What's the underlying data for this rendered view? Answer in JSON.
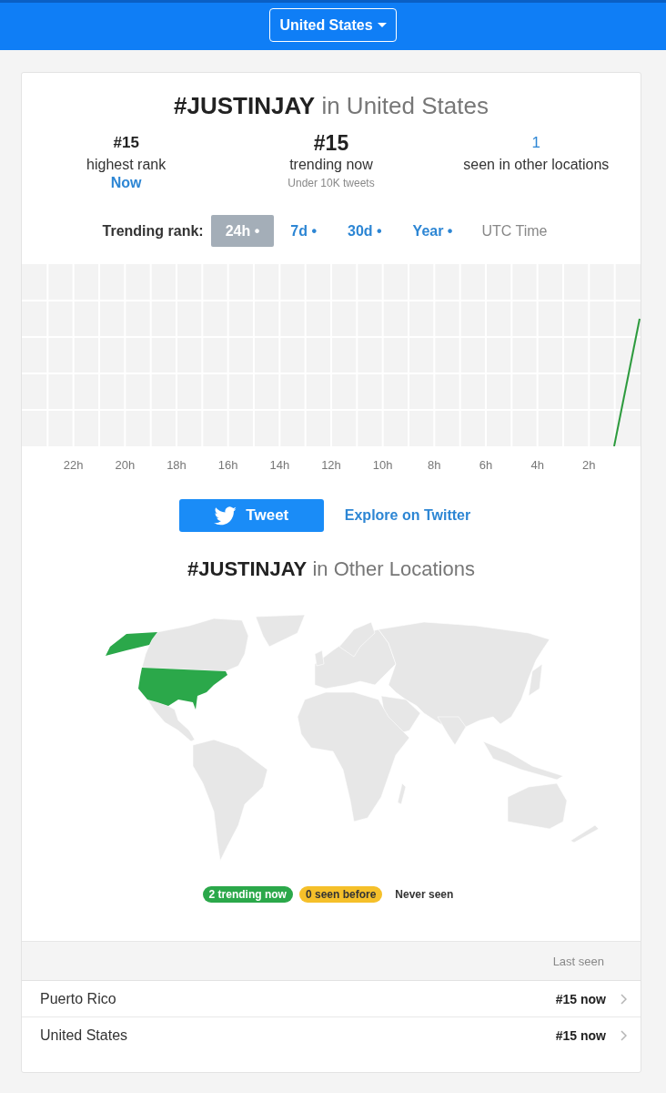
{
  "header": {
    "location_menu": "United States"
  },
  "title": "**#JUSTINJAY** in United States",
  "stats": [
    {
      "kind": "rank",
      "value": "#15",
      "label": "highest rank",
      "note": "Now"
    },
    {
      "kind": "current",
      "value": "#15",
      "label": "trending now",
      "note": "Under 10K tweets"
    },
    {
      "kind": "count",
      "value": "1",
      "label": "seen in other locations"
    }
  ],
  "range": {
    "label": "Trending rank:",
    "tabs": [
      {
        "label": "24h •",
        "selected": true
      },
      {
        "label": "7d •",
        "selected": false
      },
      {
        "label": "30d •",
        "selected": false
      },
      {
        "label": "Year •",
        "selected": false
      }
    ],
    "time_zone": "UTC Time"
  },
  "chart": {
    "x_labels": [
      "22h",
      "20h",
      "18h",
      "16h",
      "14h",
      "12h",
      "10h",
      "8h",
      "6h",
      "4h",
      "2h"
    ]
  },
  "actions": {
    "tweet": "Tweet",
    "explore": "Explore on Twitter"
  },
  "locations": {
    "title": "**#JUSTINJAY** in Other Locations",
    "legend": [
      {
        "kind": "trending",
        "label": "2 trending now",
        "color": "#2ba84a"
      },
      {
        "kind": "seen",
        "label": "0 seen before",
        "color": "#f5c02a"
      },
      {
        "kind": "never",
        "label": "Never seen"
      }
    ],
    "table": {
      "last_seen_header": "Last seen",
      "rows": [
        {
          "location": "Puerto Rico",
          "last_seen": "#15 now"
        },
        {
          "location": "United States",
          "last_seen": "#15 now"
        }
      ]
    }
  }
}
